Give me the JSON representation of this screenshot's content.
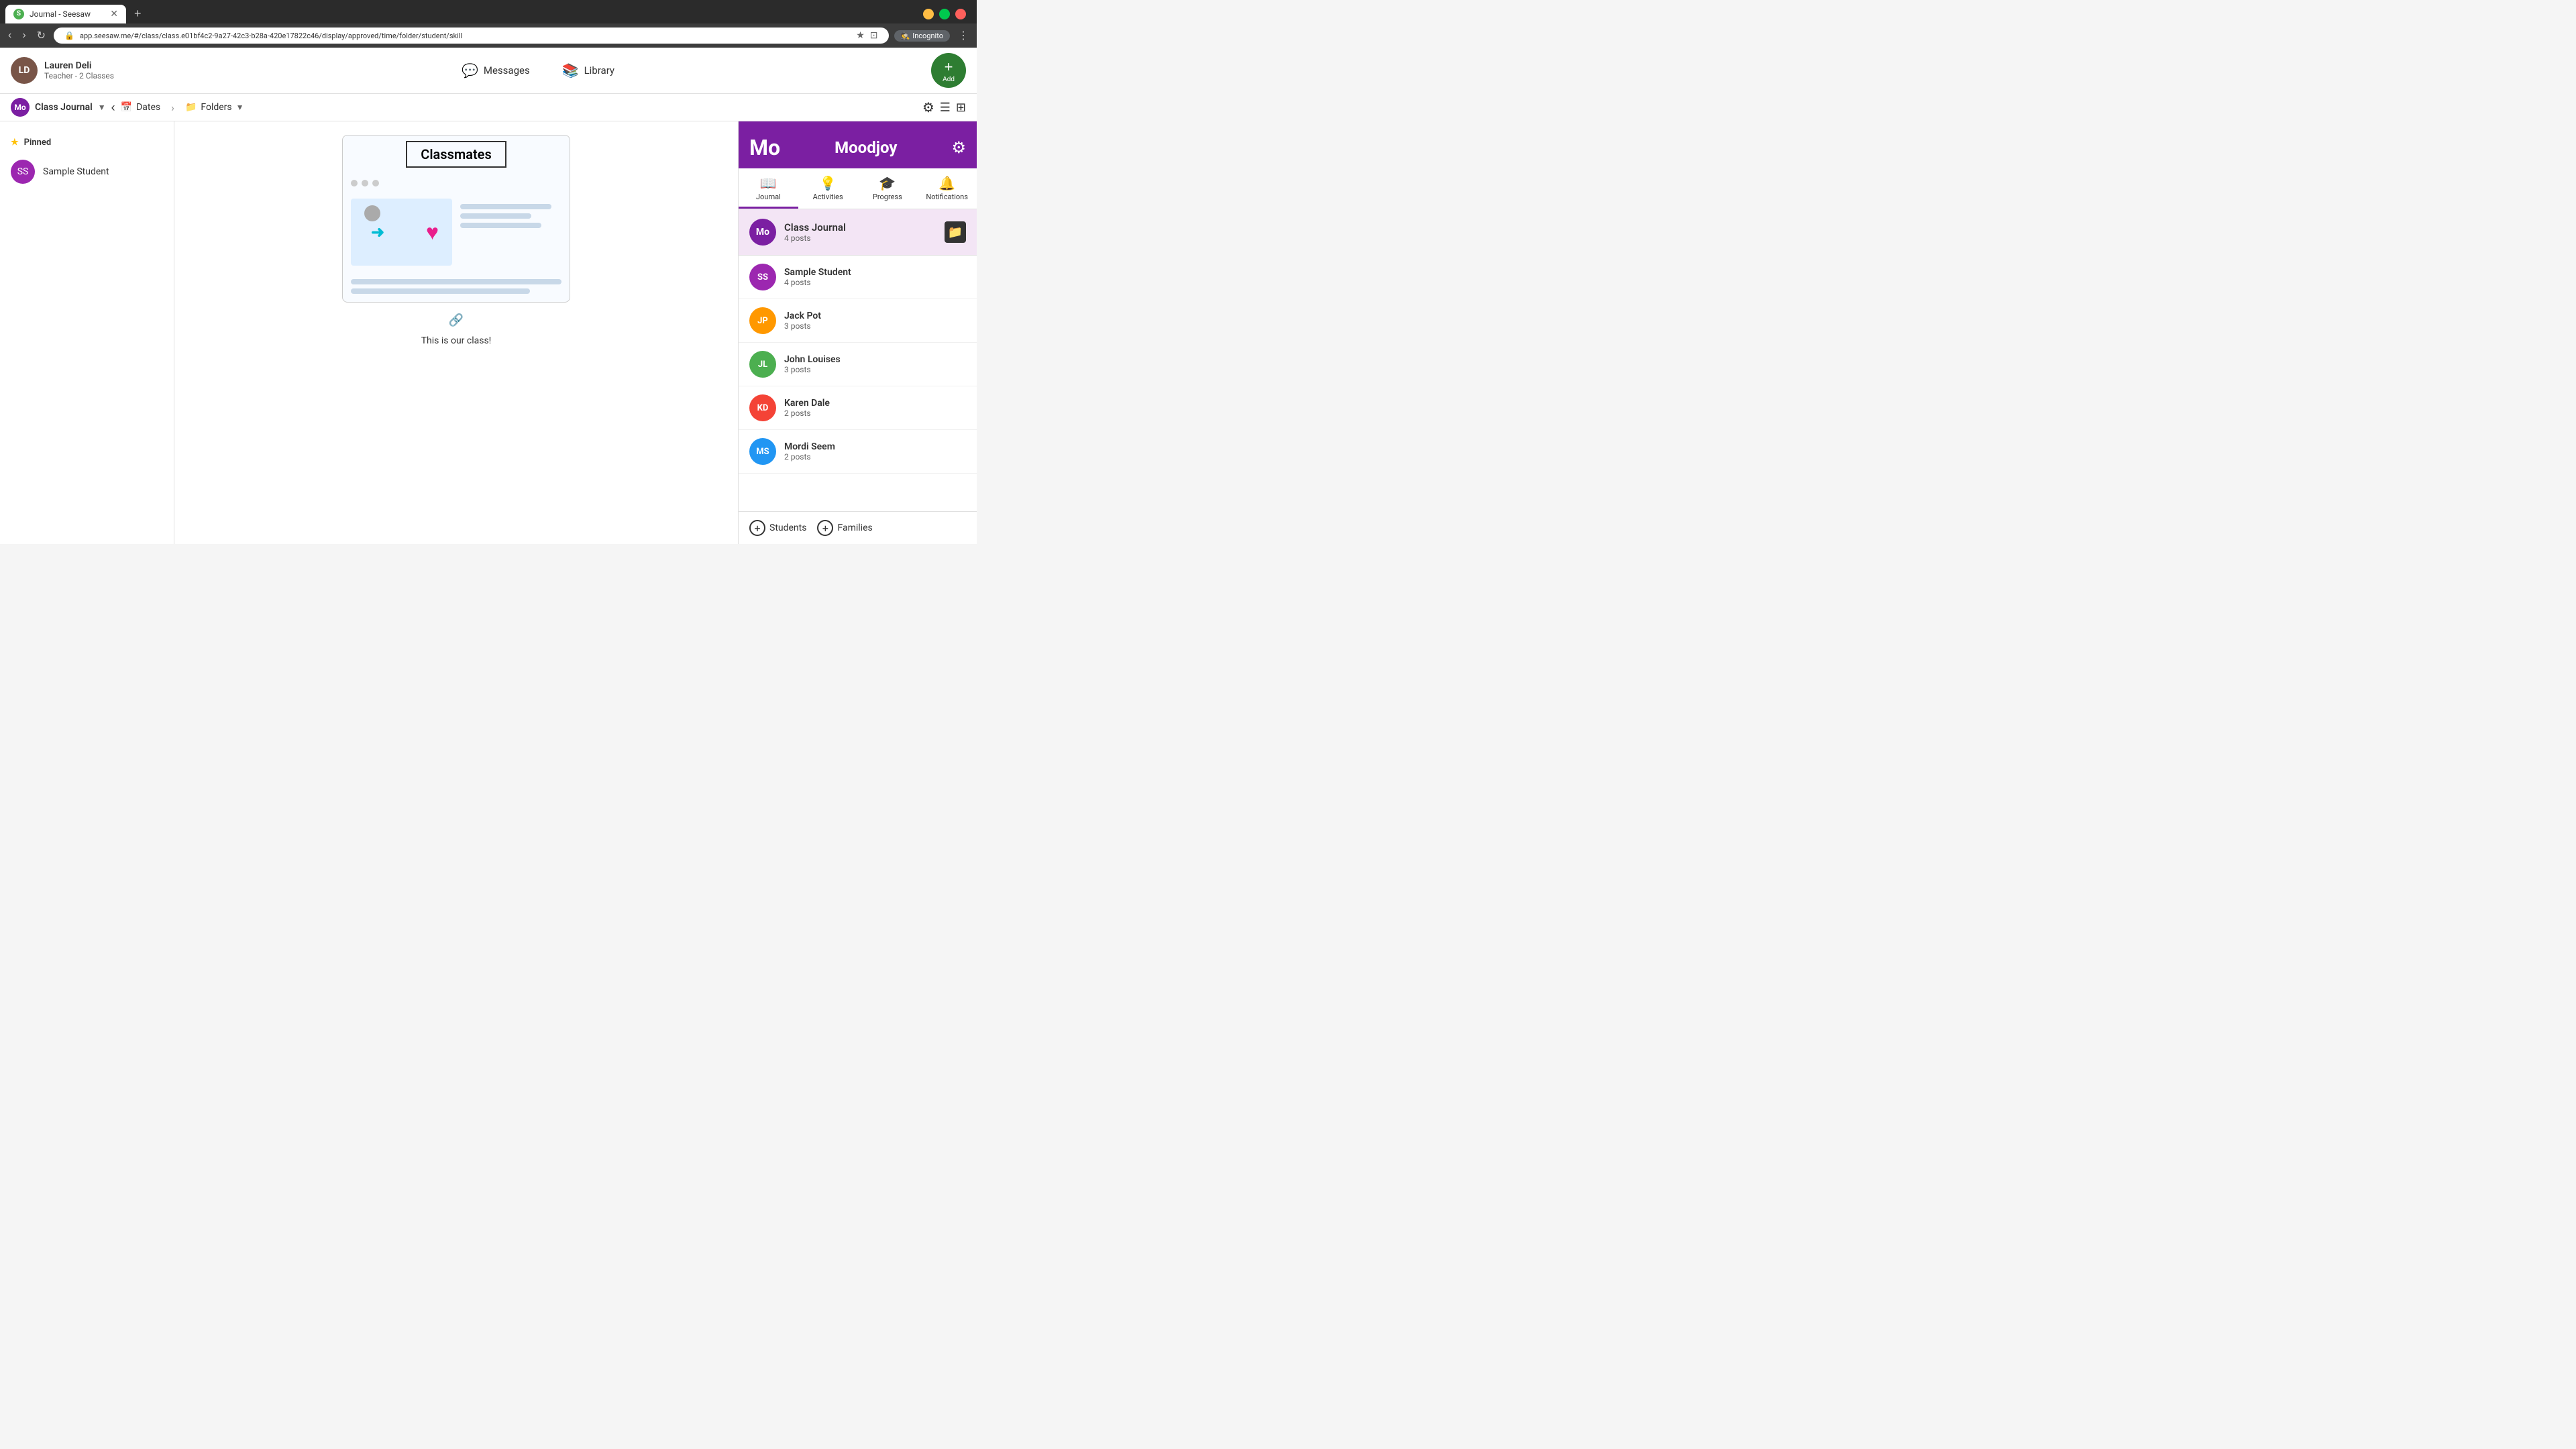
{
  "browser": {
    "tab_title": "Journal - Seesaw",
    "tab_favicon": "S",
    "url": "app.seesaw.me/#/class/class.e01bf4c2-9a27-42c3-b28a-420e17822c46/display/approved/time/folder/student/skill",
    "incognito_label": "Incognito",
    "new_tab_btn": "+"
  },
  "navbar": {
    "user_name": "Lauren Deli",
    "user_role": "Teacher - 2 Classes",
    "user_initials": "LD",
    "messages_label": "Messages",
    "library_label": "Library",
    "add_label": "Add"
  },
  "class_bar": {
    "class_abbr": "Mo",
    "class_name": "Class Journal",
    "dates_label": "Dates",
    "folders_label": "Folders"
  },
  "student_sidebar": {
    "pinned_label": "Pinned",
    "students": [
      {
        "name": "Sample Student",
        "initials": "SS",
        "color": "#9c27b0"
      }
    ]
  },
  "center": {
    "card_title": "Classmates",
    "caption": "This is our class!"
  },
  "right_panel": {
    "mo_label": "Mo",
    "username": "Moodjoy",
    "settings_icon": "⚙",
    "tabs": [
      {
        "id": "journal",
        "label": "Journal",
        "icon": "📖",
        "active": true
      },
      {
        "id": "activities",
        "label": "Activities",
        "icon": "💡",
        "active": false
      },
      {
        "id": "progress",
        "label": "Progress",
        "icon": "🎓",
        "active": false
      },
      {
        "id": "notifications",
        "label": "Notifications",
        "icon": "🔔",
        "active": false
      }
    ],
    "class_journal": {
      "abbr": "Mo",
      "title": "Class Journal",
      "posts": "4 posts"
    },
    "students": [
      {
        "name": "Sample Student",
        "initials": "SS",
        "posts": "4 posts",
        "color": "#9c27b0"
      },
      {
        "name": "Jack Pot",
        "initials": "JP",
        "posts": "3 posts",
        "color": "#ff9800"
      },
      {
        "name": "John Louises",
        "initials": "JL",
        "posts": "3 posts",
        "color": "#4caf50"
      },
      {
        "name": "Karen Dale",
        "initials": "KD",
        "posts": "2 posts",
        "color": "#f44336"
      },
      {
        "name": "Mordi Seem",
        "initials": "MS",
        "posts": "2 posts",
        "color": "#2196f3"
      }
    ],
    "students_btn": "Students",
    "families_btn": "Families"
  }
}
